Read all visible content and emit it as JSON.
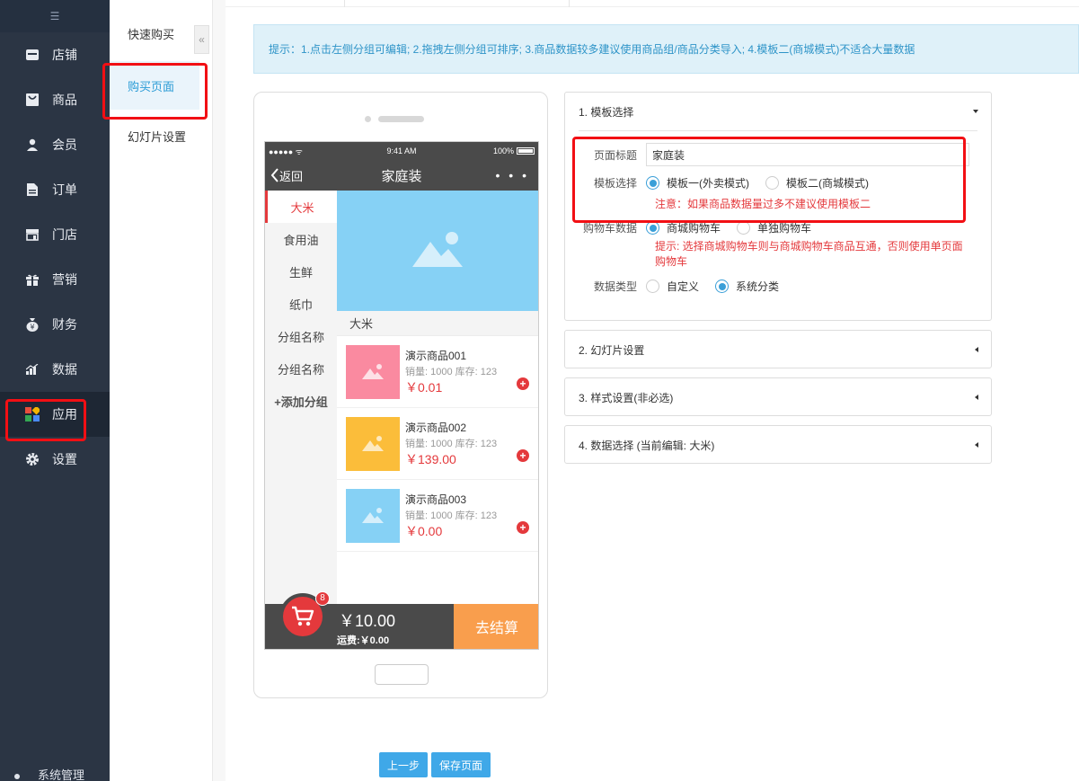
{
  "sidebar": {
    "collapse_glyph": "☰",
    "items": [
      {
        "label": "店铺",
        "icon": "store-icon"
      },
      {
        "label": "商品",
        "icon": "goods-icon"
      },
      {
        "label": "会员",
        "icon": "member-icon"
      },
      {
        "label": "订单",
        "icon": "order-icon"
      },
      {
        "label": "门店",
        "icon": "shop-icon"
      },
      {
        "label": "营销",
        "icon": "gift-icon"
      },
      {
        "label": "财务",
        "icon": "money-bag-icon"
      },
      {
        "label": "数据",
        "icon": "chart-icon"
      },
      {
        "label": "应用",
        "icon": "apps-icon",
        "active": true
      },
      {
        "label": "设置",
        "icon": "gear-icon"
      }
    ],
    "bottom_label": "系统管理"
  },
  "submenu": {
    "items": [
      {
        "label": "快速购买"
      },
      {
        "label": "购买页面",
        "active": true
      },
      {
        "label": "幻灯片设置"
      }
    ],
    "collapse_glyph": "«"
  },
  "notice": "提示：1.点击左侧分组可编辑; 2.拖拽左侧分组可排序; 3.商品数据较多建议使用商品组/商品分类导入; 4.模板二(商城模式)不适合大量数据",
  "phone": {
    "status": {
      "signal": "●●●●● ᯤ",
      "time": "9:41 AM",
      "battery": "100%"
    },
    "nav": {
      "back": "返回",
      "title": "家庭装",
      "more": "• • •"
    },
    "categories": [
      "大米",
      "食用油",
      "生鲜",
      "纸巾",
      "分组名称",
      "分组名称"
    ],
    "add_category": "+添加分组",
    "section_title": "大米",
    "products": [
      {
        "name": "演示商品001",
        "stats": "销量: 1000 库存: 123",
        "price": "￥0.01",
        "color": "#fa8aa0"
      },
      {
        "name": "演示商品002",
        "stats": "销量: 1000 库存: 123",
        "price": "￥139.00",
        "color": "#fbbd3a"
      },
      {
        "name": "演示商品003",
        "stats": "销量: 1000 库存: 123",
        "price": "￥0.00",
        "color": "#86d1f5"
      }
    ],
    "cart": {
      "badge": "8",
      "total": "￥10.00",
      "shipping": "运费:￥0.00",
      "checkout": "去结算"
    }
  },
  "panels": {
    "template": {
      "title": "1. 模板选择",
      "page_title_label": "页面标题",
      "page_title_value": "家庭装",
      "template_label": "模板选择",
      "template_opt1": "模板一(外卖模式)",
      "template_opt2": "模板二(商城模式)",
      "template_warn": "注意：如果商品数据量过多不建议使用模板二",
      "cart_label": "购物车数据",
      "cart_opt1": "商城购物车",
      "cart_opt2": "单独购物车",
      "cart_tip1": "提示: 选择商城购物车则与商城购物车商品互通，否则使用单页面",
      "cart_tip2": "购物车",
      "datatype_label": "数据类型",
      "datatype_opt1": "自定义",
      "datatype_opt2": "系统分类"
    },
    "slides": {
      "title": "2. 幻灯片设置"
    },
    "style": {
      "title": "3. 样式设置(非必选)"
    },
    "data": {
      "title": "4. 数据选择 (当前编辑: 大米)"
    }
  },
  "buttons": {
    "prev": "上一步",
    "save": "保存页面"
  },
  "colors": {
    "sidebar": "#2b3544",
    "accent": "#3fa8e8",
    "warn": "#e4393c",
    "highlight": "#f20f14"
  }
}
